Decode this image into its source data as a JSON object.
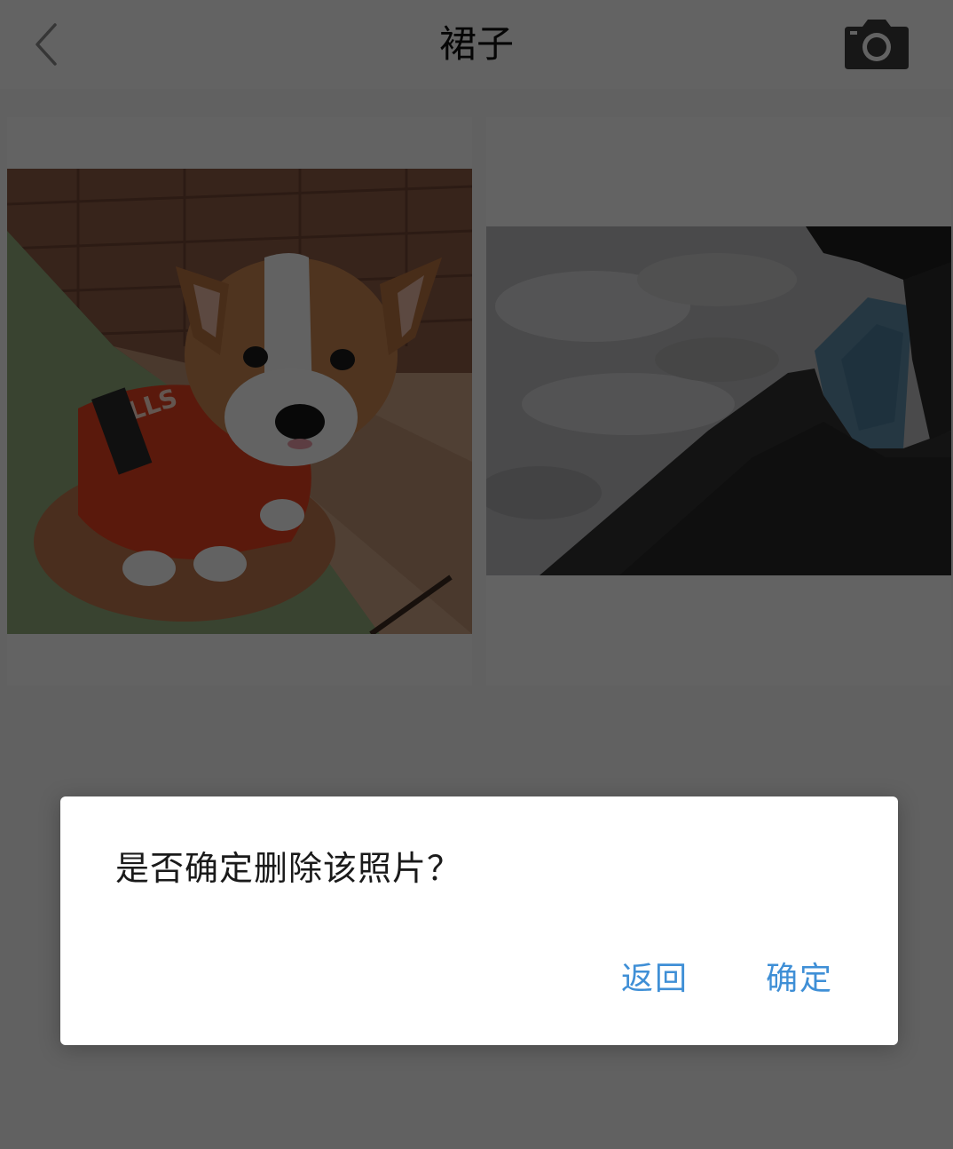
{
  "header": {
    "title": "裙子",
    "back_icon": "chevron-left-icon",
    "camera_icon": "camera-icon"
  },
  "photos": [
    {
      "name": "corgi-puppy-photo",
      "description_color": "#8a4a2a"
    },
    {
      "name": "coastal-cliff-photo",
      "description_color": "#4a6a8a"
    }
  ],
  "dialog": {
    "message": "是否确定删除该照片？",
    "cancel_label": "返回",
    "confirm_label": "确定",
    "button_color": "#3f8fd6"
  }
}
